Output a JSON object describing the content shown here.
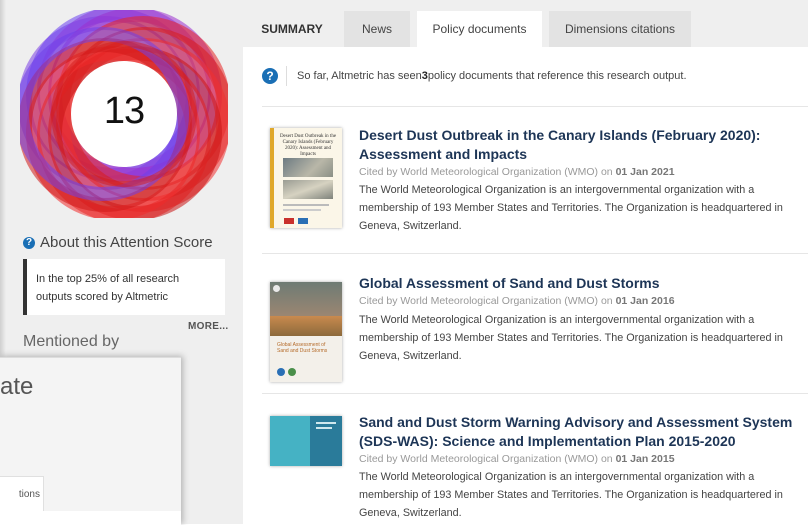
{
  "score": {
    "value": "13",
    "about_label": "About this Attention Score",
    "top_text": "In the top 25% of all research outputs scored by Altmetric",
    "more_label": "MORE...",
    "mentioned_by": "Mentioned by"
  },
  "overlay": {
    "title_fragment": "ate",
    "tab_fragment": "tions"
  },
  "tabs": [
    {
      "label": "SUMMARY"
    },
    {
      "label": "News"
    },
    {
      "label": "Policy documents"
    },
    {
      "label": "Dimensions citations"
    }
  ],
  "intro": {
    "prefix": "So far, Altmetric has seen ",
    "count": "3",
    "suffix": " policy documents that reference this research output."
  },
  "documents": [
    {
      "title": "Desert Dust Outbreak in the Canary Islands (February 2020): Assessment and Impacts",
      "cited_prefix": "Cited by World Meteorological Organization (WMO) on ",
      "cited_date": "01 Jan 2021",
      "description": "The World Meteorological Organization is an intergovernmental organization with a membership of 193 Member States and Territories. The Organization is headquartered in Geneva, Switzerland.",
      "thumb_title": "Desert Dust Outbreak in the Canary Islands (February 2020): Assessment and Impacts"
    },
    {
      "title": "Global Assessment of Sand and Dust Storms",
      "cited_prefix": "Cited by World Meteorological Organization (WMO) on ",
      "cited_date": "01 Jan 2016",
      "description": "The World Meteorological Organization is an intergovernmental organization with a membership of 193 Member States and Territories. The Organization is headquartered in Geneva, Switzerland.",
      "thumb_title": "Global Assessment of Sand and Dust Storms"
    },
    {
      "title": "Sand and Dust Storm Warning Advisory and Assessment System (SDS-WAS): Science and Implementation Plan 2015-2020",
      "cited_prefix": "Cited by World Meteorological Organization (WMO) on ",
      "cited_date": "01 Jan 2015",
      "description": "The World Meteorological Organization is an intergovernmental organization with a membership of 193 Member States and Territories. The Organization is headquartered in Geneva, Switzerland."
    }
  ],
  "icons": {
    "question": "question-circle-icon"
  },
  "colors": {
    "donut_policy": "#e31c1c",
    "donut_news": "#7d3fe0",
    "title_link": "#1d3556",
    "question_icon": "#1a6fb5"
  }
}
